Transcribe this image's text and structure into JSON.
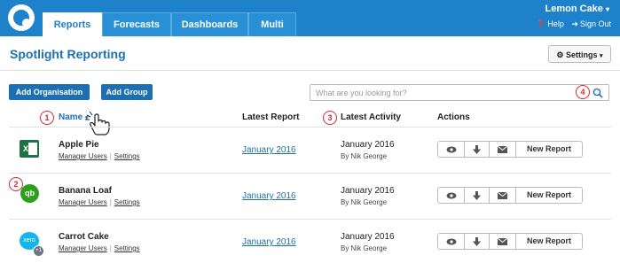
{
  "nav": {
    "tabs": [
      {
        "label": "Reports"
      },
      {
        "label": "Forecasts"
      },
      {
        "label": "Dashboards"
      },
      {
        "label": "Multi"
      }
    ]
  },
  "user": {
    "name": "Lemon Cake",
    "help": "Help",
    "sign_out": "Sign Out"
  },
  "page": {
    "title": "Spotlight Reporting",
    "settings_label": "Settings"
  },
  "toolbar": {
    "add_org": "Add Organisation",
    "add_group": "Add Group",
    "search_placeholder": "What are you looking for?"
  },
  "markers": [
    "1",
    "2",
    "3",
    "4"
  ],
  "table": {
    "headers": {
      "name": "Name",
      "report": "Latest Report",
      "activity": "Latest Activity",
      "actions": "Actions"
    },
    "rows": [
      {
        "name": "Apple Pie",
        "manager": "Manager Users",
        "settings": "Settings",
        "report": "January 2016",
        "activity_date": "January 2016",
        "activity_by": "By Nik George",
        "new_report": "New Report",
        "logo": "excel-icon",
        "logo_text": "X"
      },
      {
        "name": "Banana Loaf",
        "manager": "Manager Users",
        "settings": "Settings",
        "report": "January 2016",
        "activity_date": "January 2016",
        "activity_by": "By Nik George",
        "new_report": "New Report",
        "logo": "quickbooks-icon",
        "logo_text": "qb"
      },
      {
        "name": "Carrot Cake",
        "manager": "Manager Users",
        "settings": "Settings",
        "report": "January 2016",
        "activity_date": "January 2016",
        "activity_by": "By Nik George",
        "new_report": "New Report",
        "logo": "xero-icon",
        "logo_text": "xero",
        "badge": "+1"
      }
    ]
  },
  "colors": {
    "brand": "#1d82c9",
    "link": "#1d6fb3",
    "marker": "#d9262e"
  }
}
